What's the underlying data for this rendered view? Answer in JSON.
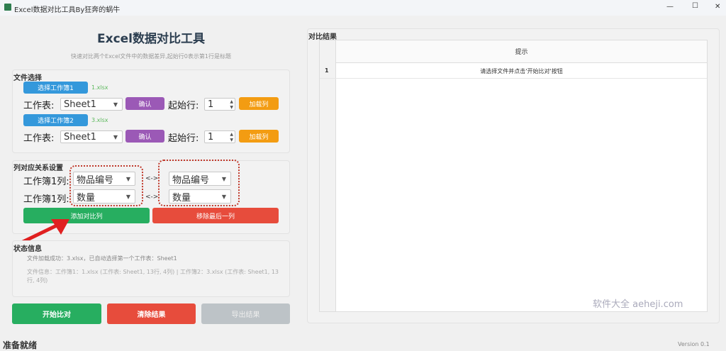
{
  "window": {
    "title": "Excel数据对比工具By狂奔的蜗牛",
    "minimize": "—",
    "maximize": "☐",
    "close": "✕"
  },
  "header": {
    "title": "Excel数据对比工具",
    "subtitle": "快速对比两个Excel文件中的数据差异,起始行0表示第1行是标题"
  },
  "file_select": {
    "title": "文件选择",
    "wb1": {
      "button": "选择工作簿1",
      "file": "1.xlsx",
      "sheet_label": "工作表:",
      "sheet": "Sheet1",
      "confirm": "确认",
      "start_label": "起始行:",
      "start": "1",
      "load": "加载列"
    },
    "wb2": {
      "button": "选择工作簿2",
      "file": "3.xlsx",
      "sheet_label": "工作表:",
      "sheet": "Sheet1",
      "confirm": "确认",
      "start_label": "起始行:",
      "start": "1",
      "load": "加载列"
    }
  },
  "mapping": {
    "title": "列对应关系设置",
    "rows": [
      {
        "label": "工作簿1列:",
        "left": "物品编号",
        "sep": "<->",
        "right": "物品编号"
      },
      {
        "label": "工作簿1列:",
        "left": "数量",
        "sep": "<->",
        "right": "数量"
      }
    ],
    "add": "添加对比列",
    "remove": "移除最后一列"
  },
  "status": {
    "title": "状态信息",
    "line1": "文件加载成功：3.xlsx，已自动选择第一个工作表：Sheet1",
    "line2": "文件信息：工作簿1：1.xlsx (工作表: Sheet1, 13行, 4列) | 工作簿2：3.xlsx (工作表: Sheet1, 13行, 4列)"
  },
  "actions": {
    "start": "开始比对",
    "clear": "清除结果",
    "export": "导出结果"
  },
  "results": {
    "title": "对比结果",
    "header": "提示",
    "rows": [
      {
        "index": "1",
        "text": "请选择文件并点击'开始比对'按钮"
      }
    ]
  },
  "statusbar": {
    "text": "准备就绪",
    "version": "Version 0.1"
  },
  "watermark": "软件大全 aeheji.com",
  "colors": {
    "blue": "#3498db",
    "purple": "#9b59b6",
    "orange": "#f39c12",
    "green": "#27ae60",
    "red": "#e74c3c",
    "gray": "#bdc3c7"
  }
}
